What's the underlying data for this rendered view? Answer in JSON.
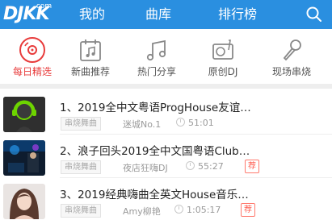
{
  "header": {
    "logo_text": "DJKK",
    "logo_suffix": ".com",
    "tabs": [
      "我的",
      "曲库",
      "排行榜"
    ],
    "search_icon": "search-icon",
    "bg_color": "#2a8fe0"
  },
  "categories": [
    {
      "label": "每日精选",
      "icon": "disc-icon",
      "active": true
    },
    {
      "label": "新曲推荐",
      "icon": "music-calendar-icon",
      "active": false
    },
    {
      "label": "热门分享",
      "icon": "music-notes-icon",
      "active": false
    },
    {
      "label": "原创DJ",
      "icon": "vinyl-arm-icon",
      "active": false
    },
    {
      "label": "现场串烧",
      "icon": "microphone-icon",
      "active": false
    }
  ],
  "tracks": [
    {
      "title": "1、2019全中文粤语ProgHouse友谊…",
      "tag": "串烧舞曲",
      "author": "迷城No.1",
      "duration": "51:01",
      "recommended": false,
      "rec_label": ""
    },
    {
      "title": "2、浪子回头2019全中文国粤语Club…",
      "tag": "串烧舞曲",
      "author": "夜店狂嗨DJ",
      "duration": "55:27",
      "recommended": true,
      "rec_label": "荐"
    },
    {
      "title": "3、2019经典嗨曲全英文House音乐…",
      "tag": "串烧舞曲",
      "author": "Amy柳艳",
      "duration": "1:05:17",
      "recommended": true,
      "rec_label": "荐"
    }
  ],
  "colors": {
    "active": "#e83b3b",
    "recommend": "#ff5a4d"
  }
}
